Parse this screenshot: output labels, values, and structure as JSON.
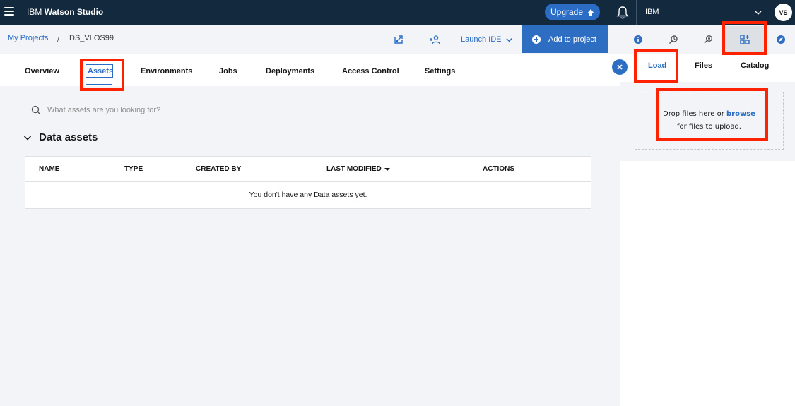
{
  "header": {
    "brand_prefix": "IBM",
    "brand_name": "Watson Studio",
    "upgrade_label": "Upgrade",
    "account_label": "IBM",
    "avatar_initials": "VS"
  },
  "breadcrumb": {
    "root_label": "My Projects",
    "separator": "/",
    "current_label": "DS_VLOS99"
  },
  "actions": {
    "launch_ide_label": "Launch IDE",
    "add_to_project_label": "Add to project"
  },
  "tabs": [
    {
      "label": "Overview"
    },
    {
      "label": "Assets"
    },
    {
      "label": "Environments"
    },
    {
      "label": "Jobs"
    },
    {
      "label": "Deployments"
    },
    {
      "label": "Access Control"
    },
    {
      "label": "Settings"
    }
  ],
  "search": {
    "placeholder": "What assets are you looking for?"
  },
  "data_assets": {
    "title": "Data assets",
    "columns": [
      "NAME",
      "TYPE",
      "CREATED BY",
      "LAST MODIFIED",
      "ACTIONS"
    ],
    "empty_message": "You don't have any Data assets yet."
  },
  "right_panel": {
    "icons": [
      "info-icon",
      "lookup-icon",
      "find-replace-icon",
      "data-assets-grid-icon",
      "compass-icon"
    ],
    "tabs": [
      {
        "label": "Load"
      },
      {
        "label": "Files"
      },
      {
        "label": "Catalog"
      }
    ],
    "dropzone": {
      "text_before": "Drop files here or",
      "browse_link": "browse",
      "text_after": "for files to upload."
    }
  },
  "colors": {
    "topbar_bg": "#13293d",
    "accent_blue": "#2b6cc4",
    "annotation_red": "#ff2200"
  }
}
